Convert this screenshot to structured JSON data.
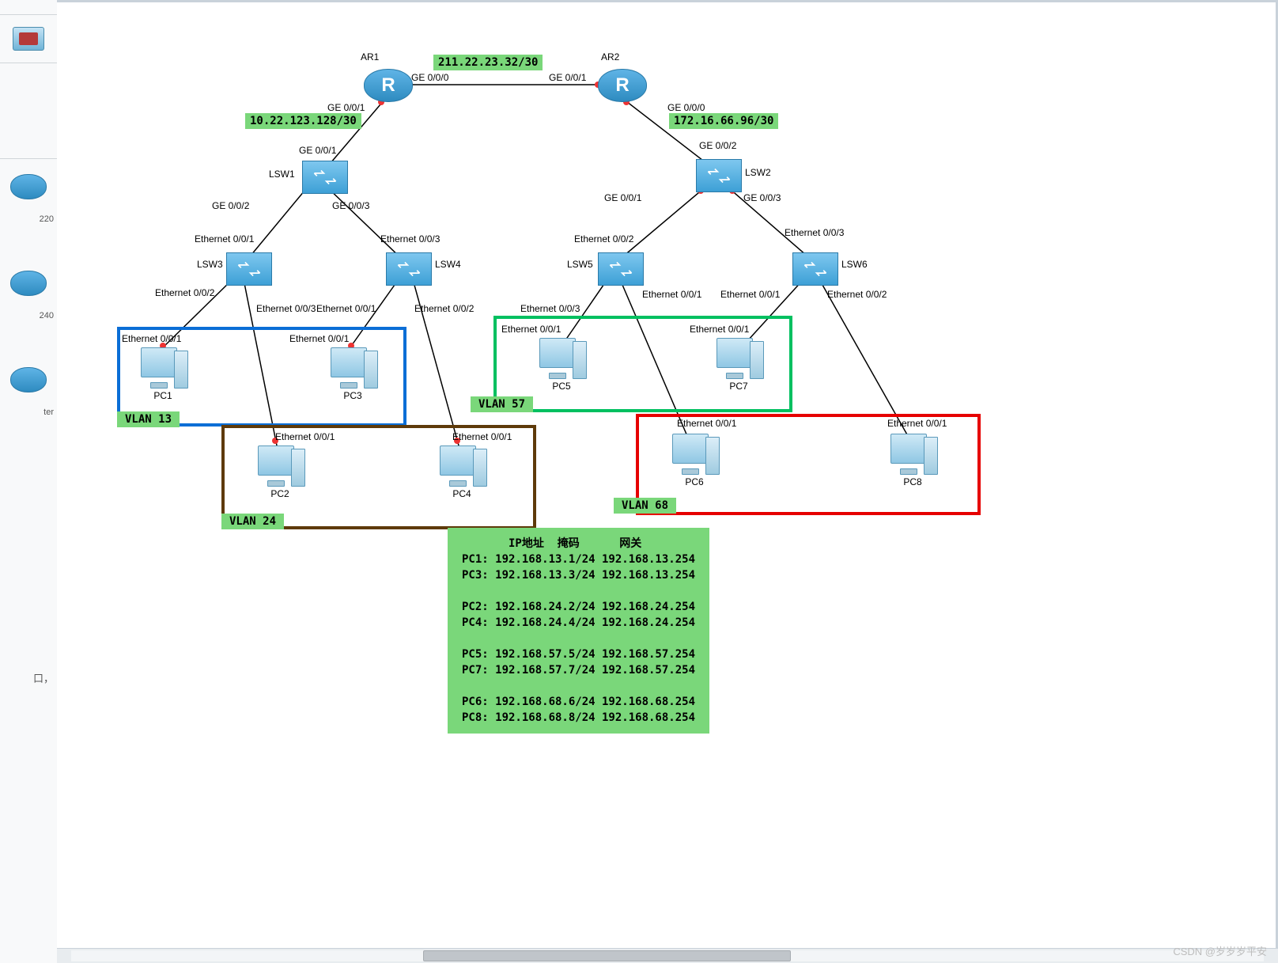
{
  "left_panel": {
    "truncated_220": "220",
    "truncated_240": "240",
    "truncated_ter": "ter",
    "truncated_kou": "口，"
  },
  "devices": {
    "AR1": "AR1",
    "AR2": "AR2",
    "LSW1": "LSW1",
    "LSW2": "LSW2",
    "LSW3": "LSW3",
    "LSW4": "LSW4",
    "LSW5": "LSW5",
    "LSW6": "LSW6",
    "PC1": "PC1",
    "PC2": "PC2",
    "PC3": "PC3",
    "PC4": "PC4",
    "PC5": "PC5",
    "PC6": "PC6",
    "PC7": "PC7",
    "PC8": "PC8"
  },
  "subnets": {
    "wan": "211.22.23.32/30",
    "left": "10.22.123.128/30",
    "right": "172.16.66.96/30"
  },
  "ports": {
    "ar1_ge000": "GE 0/0/0",
    "ar2_ge001": "GE 0/0/1",
    "ar1_ge001": "GE 0/0/1",
    "lsw1_ge001_top": "GE 0/0/1",
    "ar2_ge000": "GE 0/0/0",
    "lsw2_ge002_top": "GE 0/0/2",
    "lsw1_ge002": "GE 0/0/2",
    "lsw1_ge003": "GE 0/0/3",
    "lsw3_e001_top": "Ethernet 0/0/1",
    "lsw4_e003_top": "Ethernet 0/0/3",
    "lsw2_ge001": "GE 0/0/1",
    "lsw2_ge003": "GE 0/0/3",
    "lsw5_e002_top": "Ethernet 0/0/2",
    "lsw6_e003_top": "Ethernet 0/0/3",
    "lsw3_e002": "Ethernet 0/0/2",
    "lsw3_e003": "Ethernet 0/0/3",
    "lsw4_e001": "Ethernet 0/0/1",
    "lsw4_e002": "Ethernet 0/0/2",
    "lsw5_e003": "Ethernet 0/0/3",
    "lsw5_e001": "Ethernet 0/0/1",
    "lsw6_e001": "Ethernet 0/0/1",
    "lsw6_e002": "Ethernet 0/0/2",
    "pc1_e001": "Ethernet 0/0/1",
    "pc3_e001": "Ethernet 0/0/1",
    "pc2_e001": "Ethernet 0/0/1",
    "pc4_e001": "Ethernet 0/0/1",
    "pc5_e001": "Ethernet 0/0/1",
    "pc7_e001": "Ethernet 0/0/1",
    "pc6_e001": "Ethernet 0/0/1",
    "pc8_e001": "Ethernet 0/0/1"
  },
  "vlans": {
    "v13": "VLAN  13",
    "v24": "VLAN  24",
    "v57": "VLAN  57",
    "v68": "VLAN  68"
  },
  "ip_table": {
    "header": "       IP地址  掩码      网关",
    "rows": [
      "PC1: 192.168.13.1/24 192.168.13.254",
      "PC3: 192.168.13.3/24 192.168.13.254",
      "",
      "PC2: 192.168.24.2/24 192.168.24.254",
      "PC4: 192.168.24.4/24 192.168.24.254",
      "",
      "PC5: 192.168.57.5/24 192.168.57.254",
      "PC7: 192.168.57.7/24 192.168.57.254",
      "",
      "PC6: 192.168.68.6/24 192.168.68.254",
      "PC8: 192.168.68.8/24 192.168.68.254"
    ]
  },
  "watermark": "CSDN @岁岁岁平安"
}
